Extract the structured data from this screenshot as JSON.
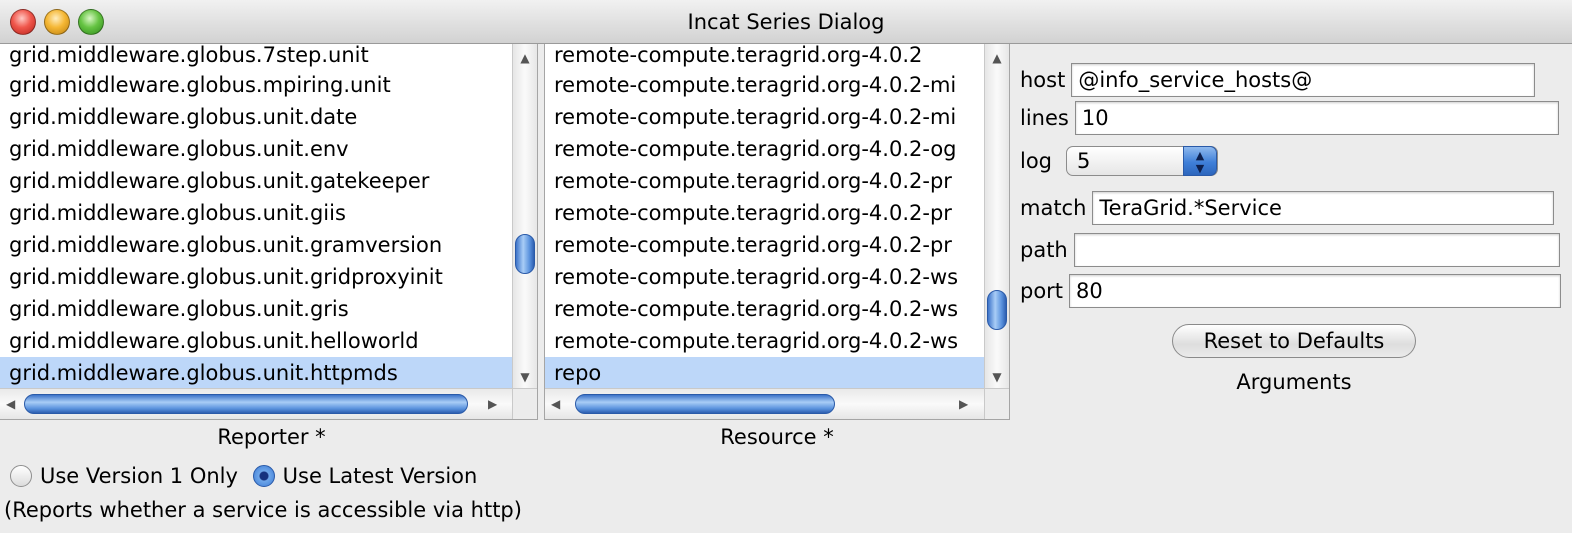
{
  "window": {
    "title": "Incat Series Dialog"
  },
  "reporter": {
    "items": [
      "grid.middleware.globus.7step.unit",
      "grid.middleware.globus.mpiring.unit",
      "grid.middleware.globus.unit.date",
      "grid.middleware.globus.unit.env",
      "grid.middleware.globus.unit.gatekeeper",
      "grid.middleware.globus.unit.giis",
      "grid.middleware.globus.unit.gramversion",
      "grid.middleware.globus.unit.gridproxyinit",
      "grid.middleware.globus.unit.gris",
      "grid.middleware.globus.unit.helloworld",
      "grid.middleware.globus.unit.httpmds"
    ],
    "selected_index": 10,
    "caption": "Reporter *"
  },
  "resource": {
    "items": [
      "remote-compute.teragrid.org-4.0.2",
      "remote-compute.teragrid.org-4.0.2-mi",
      "remote-compute.teragrid.org-4.0.2-mi",
      "remote-compute.teragrid.org-4.0.2-og",
      "remote-compute.teragrid.org-4.0.2-pr",
      "remote-compute.teragrid.org-4.0.2-pr",
      "remote-compute.teragrid.org-4.0.2-pr",
      "remote-compute.teragrid.org-4.0.2-ws",
      "remote-compute.teragrid.org-4.0.2-ws",
      "remote-compute.teragrid.org-4.0.2-ws",
      "repo"
    ],
    "selected_index": 10,
    "caption": "Resource *"
  },
  "version": {
    "option1": "Use Version 1 Only",
    "option2": "Use Latest Version",
    "selected": "Use Latest Version"
  },
  "description": "(Reports whether a service is accessible via http)",
  "arguments": {
    "host": {
      "label": "host",
      "value": "@info_service_hosts@"
    },
    "lines": {
      "label": "lines",
      "value": "10"
    },
    "log": {
      "label": "log",
      "value": "5"
    },
    "match": {
      "label": "match",
      "value": "TeraGrid.*Service"
    },
    "path": {
      "label": "path",
      "value": ""
    },
    "port": {
      "label": "port",
      "value": "80"
    },
    "reset_label": "Reset to Defaults",
    "caption": "Arguments"
  },
  "colors": {
    "selection": "#bdd7f9",
    "scroll_thumb": "#5b93de"
  }
}
